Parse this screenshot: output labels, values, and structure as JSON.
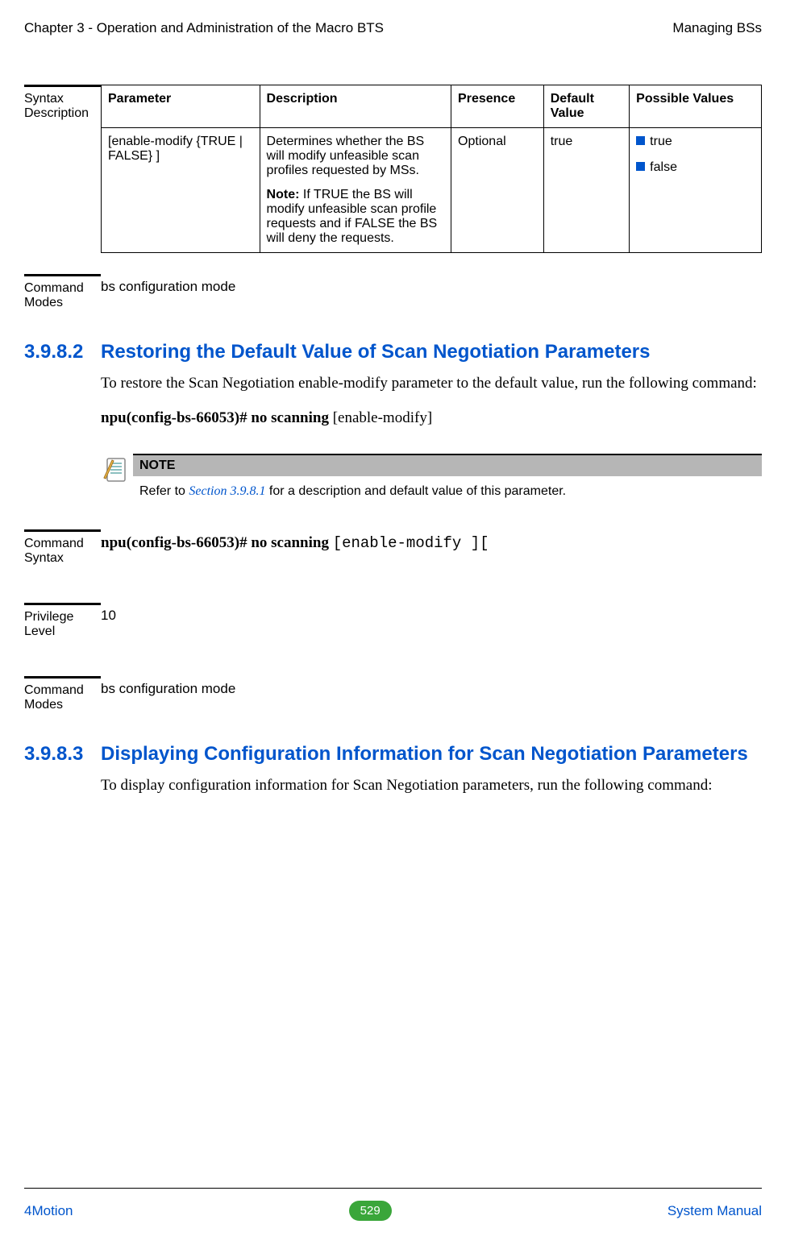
{
  "header": {
    "left": "Chapter 3 - Operation and Administration of the Macro BTS",
    "right": "Managing BSs"
  },
  "syntax_desc": {
    "label": "Syntax Description",
    "headers": {
      "param": "Parameter",
      "desc": "Description",
      "presence": "Presence",
      "default": "Default Value",
      "possible": "Possible Values"
    },
    "row": {
      "param": "[enable-modify {TRUE | FALSE} ]",
      "desc_main": "Determines whether the BS will modify unfeasible scan profiles requested by MSs.",
      "desc_note_label": "Note:",
      "desc_note_text": " If TRUE the BS will modify unfeasible scan profile requests and if FALSE the BS will deny the requests.",
      "presence": "Optional",
      "default": "true",
      "pv1": "true",
      "pv2": "false"
    }
  },
  "cmd_modes1": {
    "label": "Command Modes",
    "value": "bs configuration mode"
  },
  "sec_3982": {
    "num": "3.9.8.2",
    "title": "Restoring the Default Value of Scan Negotiation Parameters",
    "body": "To restore the Scan Negotiation enable-modify parameter to the default value, run the following command:",
    "cmd_bold": "npu(config-bs-66053)# no scanning",
    "cmd_tail": " [enable-modify]"
  },
  "note": {
    "header": "NOTE",
    "pre": "Refer to ",
    "link": "Section 3.9.8.1",
    "post": " for a description and default value of this parameter."
  },
  "cmd_syntax": {
    "label": "Command Syntax",
    "bold": "npu(config-bs-66053)# no scanning ",
    "mono": "[enable-modify ]["
  },
  "privilege": {
    "label": "Privilege Level",
    "value": "10"
  },
  "cmd_modes2": {
    "label": "Command Modes",
    "value": "bs configuration mode"
  },
  "sec_3983": {
    "num": "3.9.8.3",
    "title": "Displaying Configuration Information for Scan Negotiation Parameters",
    "body": "To display configuration information for Scan Negotiation parameters, run the following command:"
  },
  "footer": {
    "left": "4Motion",
    "page": "529",
    "right": "System Manual"
  }
}
